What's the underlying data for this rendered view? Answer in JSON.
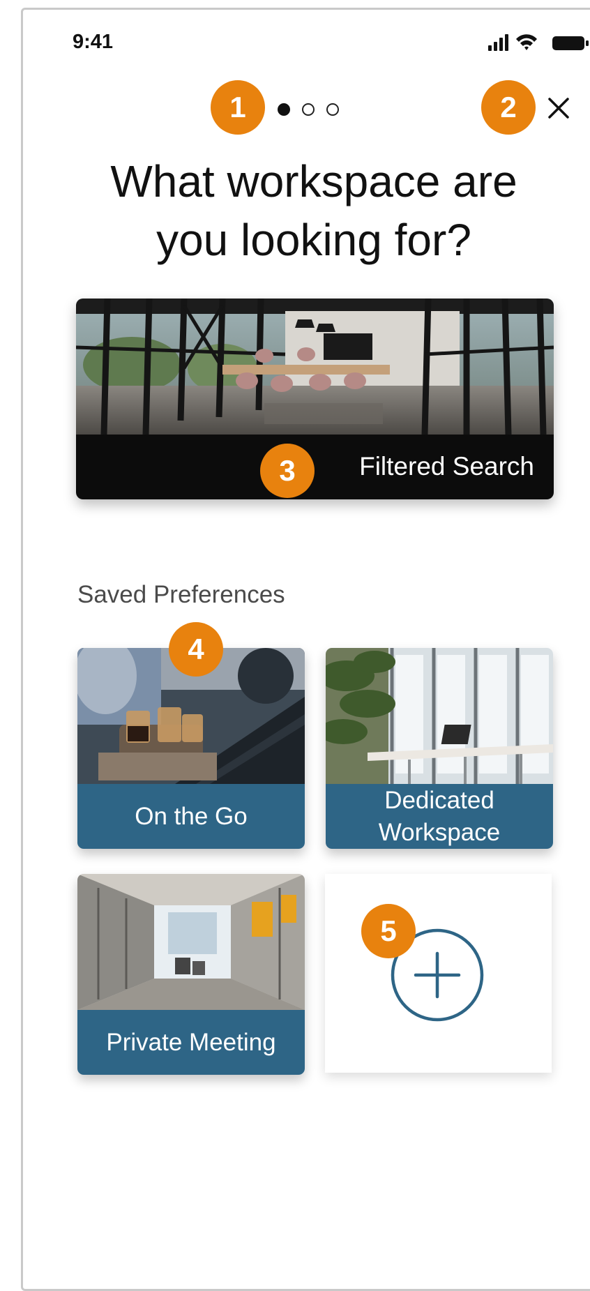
{
  "status_bar": {
    "time": "9:41",
    "icons": [
      "signal-icon",
      "wifi-icon",
      "battery-icon"
    ]
  },
  "pager": {
    "total": 3,
    "current": 1
  },
  "header": {
    "title_line1": "What workspace are",
    "title_line2": "you looking for?",
    "close_icon": "close-icon"
  },
  "hero": {
    "label": "Filtered Search",
    "image": "office-photo"
  },
  "saved": {
    "title": "Saved Preferences",
    "tiles": [
      {
        "label": "On the Go",
        "image": "cafe-laptop-photo"
      },
      {
        "label_line1": "Dedicated",
        "label_line2": "Workspace",
        "image": "desk-window-photo"
      },
      {
        "label": "Private Meeting",
        "image": "glass-office-photo"
      }
    ],
    "add_icon": "plus-circle-icon"
  },
  "annotations": [
    "1",
    "2",
    "3",
    "4",
    "5"
  ],
  "colors": {
    "badge": "#e8820e",
    "tile_bar": "#2e6586",
    "hero_bar": "#0c0c0c",
    "add_icon": "#2e6586"
  }
}
